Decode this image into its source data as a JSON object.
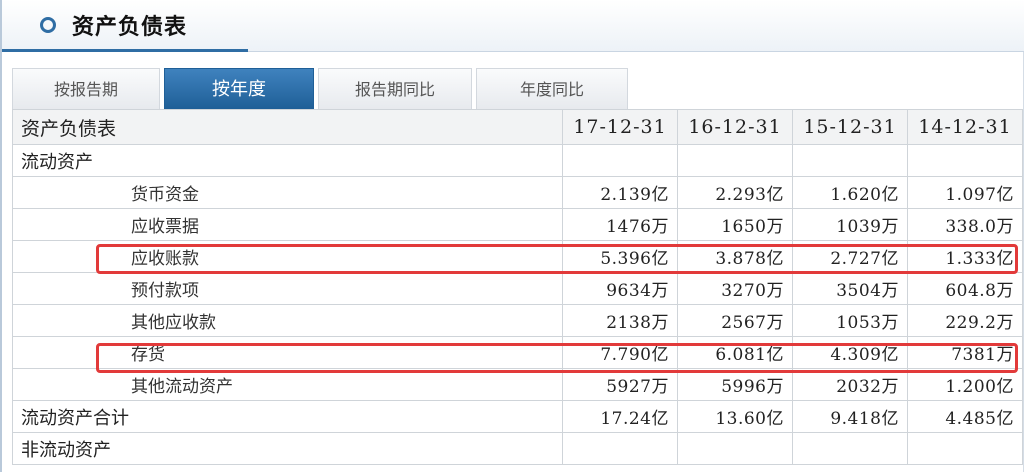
{
  "panel": {
    "title": "资产负债表"
  },
  "tabs": [
    {
      "label": "按报告期",
      "active": false
    },
    {
      "label": "按年度",
      "active": true
    },
    {
      "label": "报告期同比",
      "active": false
    },
    {
      "label": "年度同比",
      "active": false
    }
  ],
  "table": {
    "header": {
      "label": "资产负债表",
      "dates": [
        "17-12-31",
        "16-12-31",
        "15-12-31",
        "14-12-31"
      ]
    },
    "rows": [
      {
        "label": "流动资产",
        "values": [
          "",
          "",
          "",
          ""
        ]
      },
      {
        "label": "货币资金",
        "values": [
          "2.139亿",
          "2.293亿",
          "1.620亿",
          "1.097亿"
        ]
      },
      {
        "label": "应收票据",
        "values": [
          "1476万",
          "1650万",
          "1039万",
          "338.0万"
        ]
      },
      {
        "label": "应收账款",
        "values": [
          "5.396亿",
          "3.878亿",
          "2.727亿",
          "1.333亿"
        ]
      },
      {
        "label": "预付款项",
        "values": [
          "9634万",
          "3270万",
          "3504万",
          "604.8万"
        ]
      },
      {
        "label": "其他应收款",
        "values": [
          "2138万",
          "2567万",
          "1053万",
          "229.2万"
        ]
      },
      {
        "label": "存货",
        "values": [
          "7.790亿",
          "6.081亿",
          "4.309亿",
          "7381万"
        ]
      },
      {
        "label": "其他流动资产",
        "values": [
          "5927万",
          "5996万",
          "2032万",
          "1.200亿"
        ]
      },
      {
        "label": "流动资产合计",
        "values": [
          "17.24亿",
          "13.60亿",
          "9.418亿",
          "4.485亿"
        ]
      },
      {
        "label": "非流动资产",
        "values": [
          "",
          "",
          "",
          ""
        ]
      }
    ]
  },
  "colors": {
    "accent": "#2f6da4",
    "highlight": "#e23a3a"
  }
}
